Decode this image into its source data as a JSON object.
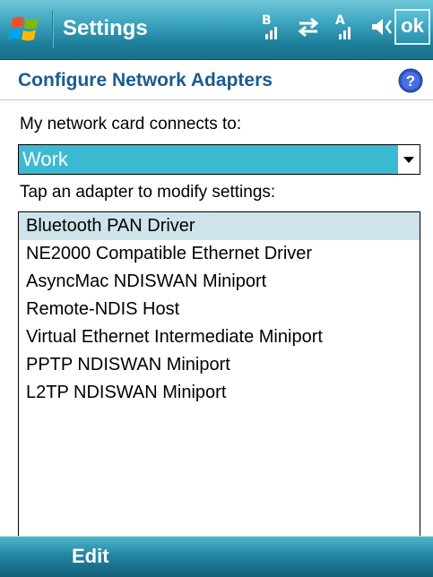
{
  "titlebar": {
    "title": "Settings",
    "ok_label": "ok",
    "icons": [
      "windows-start-icon",
      "bluetooth-signal-icon",
      "sync-arrows-icon",
      "signal-icon",
      "volume-icon"
    ]
  },
  "page": {
    "heading": "Configure Network Adapters",
    "help_icon": "help-icon"
  },
  "network": {
    "label": "My network card connects to:",
    "selected": "Work"
  },
  "adapters": {
    "label": "Tap an adapter to modify settings:",
    "items": [
      "Bluetooth PAN Driver",
      "NE2000 Compatible Ethernet Driver",
      "AsyncMac NDISWAN Miniport",
      "Remote-NDIS Host",
      "Virtual Ethernet Intermediate Miniport",
      "PPTP NDISWAN Miniport",
      "L2TP NDISWAN Miniport"
    ],
    "selected_index": 0
  },
  "softkeys": {
    "left": "Edit"
  },
  "colors": {
    "accent": "#3dbad3",
    "heading": "#1a5c8f",
    "selection": "#cfe3ea"
  }
}
